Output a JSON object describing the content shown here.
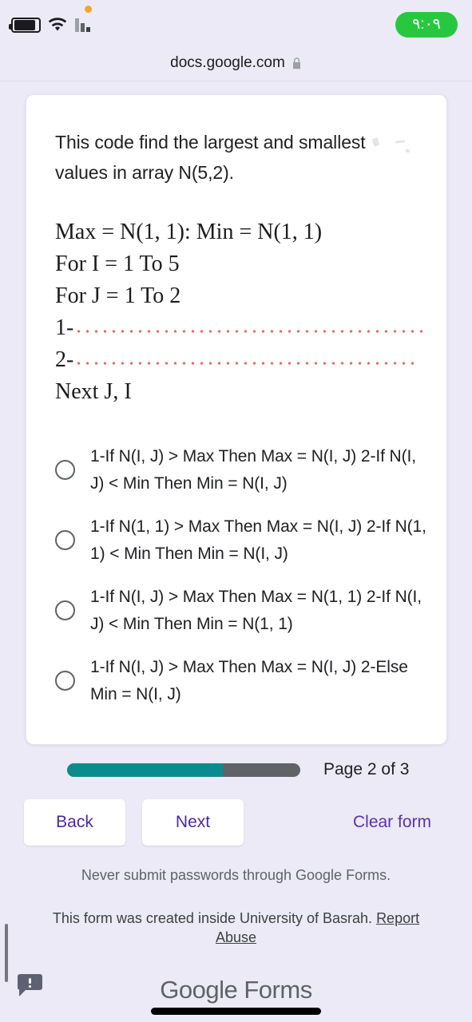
{
  "statusbar": {
    "battery_icon": "battery-icon",
    "wifi_icon": "wifi-icon",
    "signal_icon": "signal-bars-icon",
    "notification_dot": "notification-dot",
    "time": "٩:٠٩",
    "time_pill_color": "#27c840"
  },
  "browser": {
    "url": "docs.google.com",
    "lock_icon": "lock-icon"
  },
  "form": {
    "question_title": "This code find the largest and smallest values in array N(5,2).",
    "code_lines": [
      {
        "text": "Max = N(1, 1): Min = N(1, 1)",
        "dots": false
      },
      {
        "text": "For I = 1 To 5",
        "dots": false
      },
      {
        "text": "For J = 1 To 2",
        "dots": false
      },
      {
        "text": "1-",
        "dots": true
      },
      {
        "text": "2-",
        "dots": true
      },
      {
        "text": "Next J, I",
        "dots": false
      }
    ],
    "dots_color": "#e2716c",
    "options": [
      "1-If N(I, J) > Max Then Max = N(I, J) 2-If N(I, J) < Min Then Min = N(I, J)",
      "1-If N(1, 1) > Max Then Max = N(I, J) 2-If N(1, 1) < Min Then Min = N(I, J)",
      "1-If N(I, J) > Max Then Max = N(1, 1) 2-If N(I, J) < Min Then Min = N(1, 1)",
      "1-If N(I, J) > Max Then Max = N(I, J) 2-Else Min = N(I, J)"
    ],
    "selected_option": null
  },
  "progress": {
    "page_indicator": "Page 2 of 3",
    "current_page": 2,
    "total_pages": 3,
    "percent": 66.7,
    "fill_color": "#0c8b8f",
    "track_color": "#5f6368"
  },
  "buttons": {
    "back": "Back",
    "next": "Next",
    "clear_form": "Clear form",
    "accent_color": "#4a28a3"
  },
  "footer": {
    "password_notice": "Never submit passwords through Google Forms.",
    "created_notice": "This form was created inside University of Basrah.",
    "report_abuse": "Report Abuse",
    "logo_bold": "Google",
    "logo_light": "Forms",
    "feedback_icon": "feedback-bubble-icon"
  }
}
